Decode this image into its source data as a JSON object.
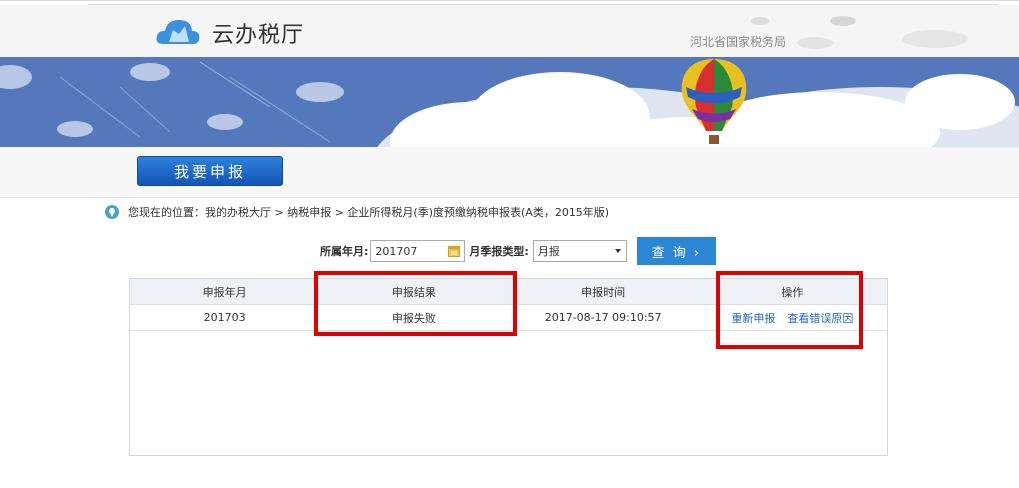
{
  "header": {
    "app_title": "云办税厅",
    "province": "河北省国家税务局"
  },
  "declare_button": "我要申报",
  "breadcrumb": {
    "text": "您现在的位置：我的办税大厅 > 纳税申报 > 企业所得税月(季)度预缴纳税申报表(A类，2015年版)"
  },
  "filters": {
    "month_label": "所属年月:",
    "month_value": "201707",
    "type_label": "月季报类型:",
    "type_value": "月报",
    "query_label": "查 询 ›"
  },
  "table": {
    "headers": [
      "申报年月",
      "申报结果",
      "申报时间",
      "操作"
    ],
    "rows": [
      {
        "month": "201703",
        "result": "申报失败",
        "time": "2017-08-17 09:10:57",
        "actions": [
          "重新申报",
          "查看错误原因"
        ]
      }
    ]
  },
  "colors": {
    "banner_blue": "#5577bb",
    "button_blue": "#1a63c2",
    "highlight_red": "#e00000",
    "link_blue": "#2266cc"
  },
  "icons": [
    "cloud-logo-icon",
    "location-pin-icon",
    "calendar-icon",
    "dropdown-arrow-icon",
    "hot-air-balloon-icon"
  ]
}
